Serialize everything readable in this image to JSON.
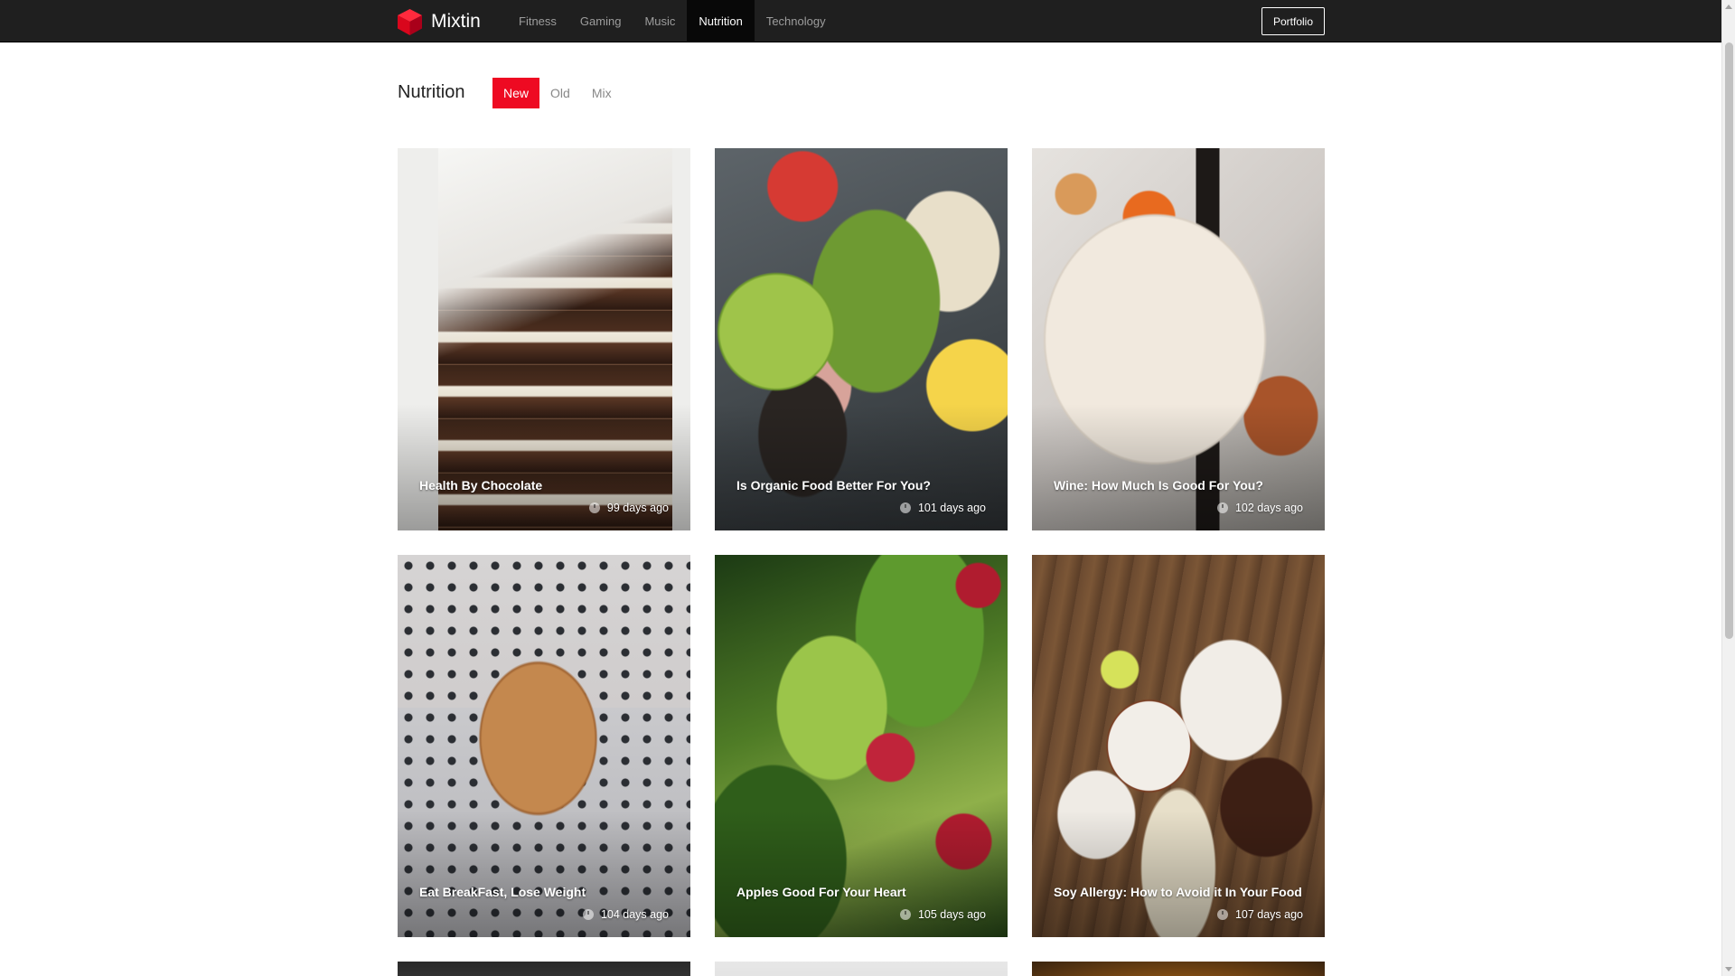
{
  "brand": {
    "name": "Mixtin",
    "logo_icon": "cube-logo-icon",
    "accent": "#ee0a22"
  },
  "nav": {
    "items": [
      {
        "label": "Fitness",
        "active": false
      },
      {
        "label": "Gaming",
        "active": false
      },
      {
        "label": "Music",
        "active": false
      },
      {
        "label": "Nutrition",
        "active": true
      },
      {
        "label": "Technology",
        "active": false
      }
    ],
    "portfolio_label": "Portfolio"
  },
  "section": {
    "title": "Nutrition",
    "filters": [
      {
        "label": "New",
        "active": true
      },
      {
        "label": "Old",
        "active": false
      },
      {
        "label": "Mix",
        "active": false
      }
    ]
  },
  "posts": [
    {
      "title": "Health By Chocolate",
      "age": "99 days ago"
    },
    {
      "title": "Is Organic Food Better For You?",
      "age": "101 days ago"
    },
    {
      "title": "Wine: How Much Is Good For You?",
      "age": "102 days ago"
    },
    {
      "title": "Eat BreakFast, Lose Weight",
      "age": "104 days ago"
    },
    {
      "title": "Apples Good For Your Heart",
      "age": "105 days ago"
    },
    {
      "title": "Soy Allergy: How to Avoid it In Your Food",
      "age": "107 days ago"
    }
  ]
}
